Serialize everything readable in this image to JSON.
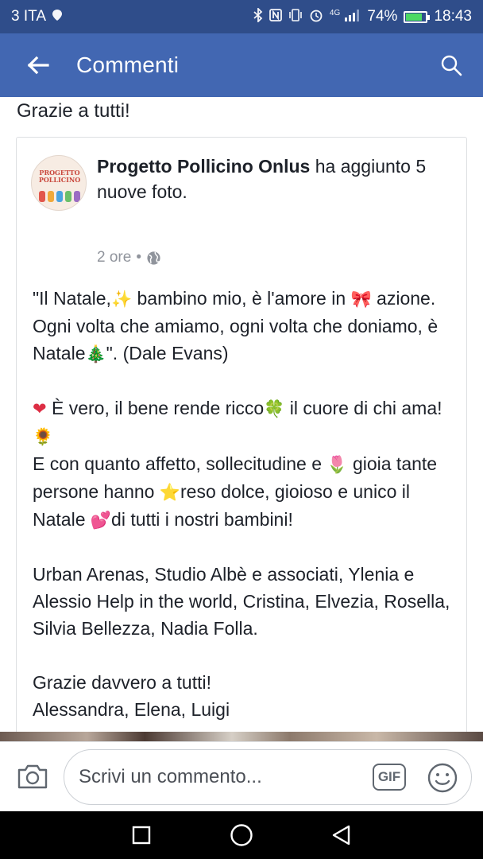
{
  "status_bar": {
    "carrier": "3 ITA",
    "network": "4G",
    "battery": "74%",
    "battery_level": 0.74,
    "time": "18:43"
  },
  "app_bar": {
    "title": "Commenti",
    "back_icon": "arrow-left-icon",
    "search_icon": "search-icon"
  },
  "previous_comment": {
    "text": "Grazie a tutti!"
  },
  "post": {
    "page_name": "Progetto Pollicino Onlus",
    "action": " ha aggiunto 5 nuove foto.",
    "avatar_line1": "PROGETTO",
    "avatar_line2": "POLLICINO",
    "time": "2 ore",
    "separator": "•",
    "audience_icon": "globe-icon",
    "body": {
      "p1_a": "\"Il Natale,",
      "p1_e1": "✨",
      "p1_b": " bambino mio, è l'amore in ",
      "p1_e2": "🎀",
      "p1_c": " azione. Ogni volta che amiamo, ogni volta che doniamo, è Natale",
      "p1_e3": "🎄",
      "p1_d": "\". (Dale Evans)",
      "p2_e1": "❤",
      "p2_a": " È vero, il bene rende ricco",
      "p2_e2": "🍀",
      "p2_b": " il cuore di chi ama!",
      "p2_e3": "🌻",
      "p3_a": "E con quanto affetto, sollecitudine e ",
      "p3_e1": "🌷",
      "p3_b": " gioia tante persone hanno ",
      "p3_e2": "⭐",
      "p3_c": "reso dolce, gioioso e unico il Natale ",
      "p3_e3": "💕",
      "p3_d": "di tutti i nostri bambini!",
      "p4": "Urban Arenas, Studio Albè e associati, Ylenia e Alessio Help in the world, Cristina, Elvezia, Rosella, Silvia Bellezza, Nadia Folla.",
      "p5_line1": "Grazie davvero a tutti!",
      "p5_line2": "Alessandra, Elena, Luigi"
    }
  },
  "composer": {
    "placeholder": "Scrivi un commento...",
    "gif_label": "GIF",
    "camera_icon": "camera-icon",
    "emoji_icon": "smiley-icon"
  },
  "nav_bar": {
    "recents_icon": "square-icon",
    "home_icon": "circle-icon",
    "back_icon": "triangle-back-icon"
  },
  "colors": {
    "status_bar": "#2f4d8a",
    "app_bar": "#4267b2",
    "text": "#1d2129",
    "meta": "#90949c",
    "nav_bar": "#000000"
  }
}
